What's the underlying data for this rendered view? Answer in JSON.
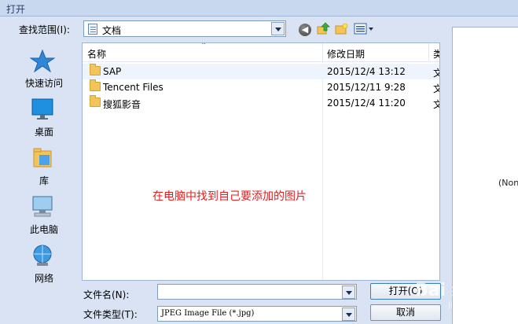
{
  "window": {
    "title": "打开"
  },
  "lookin": {
    "label": "查找范围(I):",
    "value": "文档"
  },
  "places": [
    {
      "label": "快速访问",
      "icon": "star-icon"
    },
    {
      "label": "桌面",
      "icon": "desktop-icon"
    },
    {
      "label": "库",
      "icon": "library-icon"
    },
    {
      "label": "此电脑",
      "icon": "computer-icon"
    },
    {
      "label": "网络",
      "icon": "network-icon"
    }
  ],
  "columns": {
    "name": "名称",
    "date": "修改日期",
    "type": "类"
  },
  "files": [
    {
      "name": "SAP",
      "date": "2015/12/4 13:12",
      "type": "文"
    },
    {
      "name": "Tencent Files",
      "date": "2015/12/11 9:28",
      "type": "文"
    },
    {
      "name": "搜狐影音",
      "date": "2015/12/4 11:20",
      "type": "文"
    }
  ],
  "hint": "在电脑中找到自己要添加的图片",
  "preview": {
    "placeholder": "(Non"
  },
  "filename": {
    "label": "文件名(N):",
    "value": ""
  },
  "filetype": {
    "label": "文件类型(T):",
    "value": "JPEG Image File (*.jpg)"
  },
  "buttons": {
    "open": "打开(O)",
    "cancel": "取消"
  },
  "watermark": {
    "main": "Bai 经验",
    "sub": "jingyan.baidu.com"
  },
  "colors": {
    "hint": "#e02020",
    "folder": "#f3c45a",
    "selection": "#eef4fb"
  }
}
